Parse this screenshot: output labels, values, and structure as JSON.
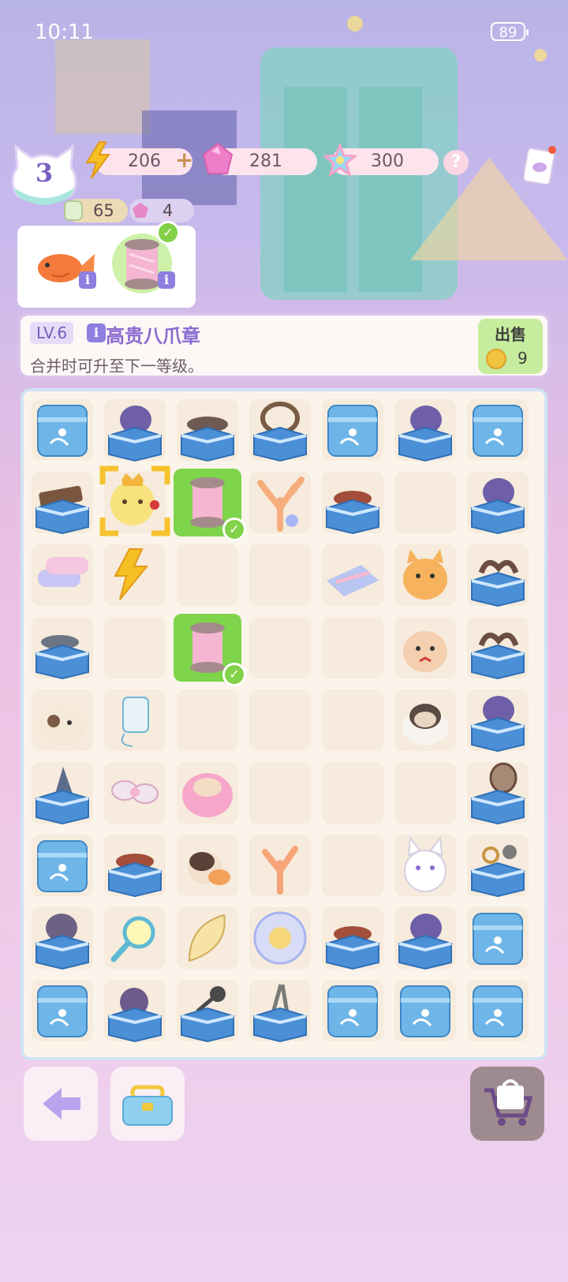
{
  "status_bar": {
    "time": "10:11",
    "battery": "89"
  },
  "player": {
    "level": "3"
  },
  "currencies": {
    "energy": {
      "value": "206",
      "plus": "+"
    },
    "gems": {
      "value": "281"
    },
    "stars": {
      "value": "300"
    },
    "help": "?"
  },
  "sub_currencies": {
    "exp": {
      "value": "65",
      "icon_label": "Exp"
    },
    "ticket": {
      "value": "4"
    }
  },
  "order": {
    "items": [
      {
        "name": "goldfish",
        "info": "i"
      },
      {
        "name": "pink-thread-spool",
        "info": "i",
        "done": true
      }
    ]
  },
  "item_info": {
    "level": "LV.6",
    "info_icon": "i",
    "title": "高贵八爪章",
    "description": "合并时可升至下一等级。",
    "sell": {
      "label": "出售",
      "price": "9"
    }
  },
  "board": {
    "rows": [
      [
        "box",
        "box-lavender",
        "box-stone",
        "box-basket",
        "box",
        "box-lavender",
        "box"
      ],
      [
        "box-wood",
        "octopus-king",
        "spool-green",
        "coral-pink",
        "box-fish",
        "empty",
        "box-lavender"
      ],
      [
        "towels",
        "energy",
        "empty",
        "empty",
        "cloth",
        "cat-orange",
        "box-rope"
      ],
      [
        "box-fish-gray",
        "empty",
        "spool-green",
        "empty",
        "empty",
        "hamster",
        "box-rope"
      ],
      [
        "cat-siamese",
        "thread",
        "empty",
        "empty",
        "empty",
        "cat-ghost",
        "box-lavender"
      ],
      [
        "box-shark",
        "ribbon",
        "pink-bun",
        "empty",
        "empty",
        "empty",
        "box-racket"
      ],
      [
        "box",
        "box-fish",
        "cat-calico",
        "coral",
        "empty",
        "cat-white",
        "box-scissors"
      ],
      [
        "box-hat",
        "magnifier",
        "leaf",
        "bubble",
        "box-fish",
        "box-lavender",
        "box"
      ],
      [
        "box",
        "box-yarn",
        "box-dumbbell",
        "box-tongs",
        "box",
        "box",
        "box"
      ]
    ]
  },
  "colors": {
    "accent": "#8a6ad0",
    "check": "#82d148",
    "board_border": "#cfe4f4"
  },
  "bottom_buttons": [
    "back-arrow-icon",
    "toolbox-icon",
    "shop-cart-icon"
  ]
}
